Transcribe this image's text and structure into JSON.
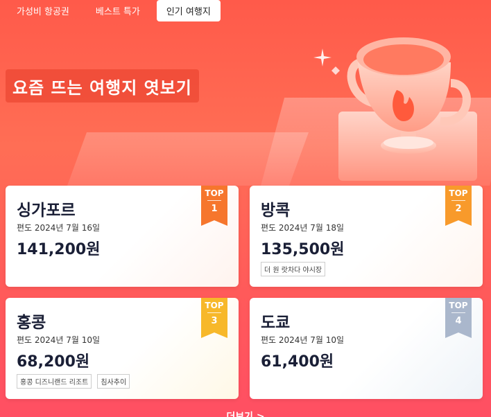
{
  "tabs": [
    {
      "label": "가성비 항공권",
      "active": false
    },
    {
      "label": "베스트 특가",
      "active": false
    },
    {
      "label": "인기 여행지",
      "active": true
    }
  ],
  "hero": {
    "title": "요즘 뜨는 여행지 엿보기"
  },
  "cards": [
    {
      "city": "싱가포르",
      "date": "편도  2024년 7월 16일",
      "price": "141,200원",
      "badge_top": "TOP",
      "badge_num": "1",
      "badge_color": "#f6762d",
      "tags": []
    },
    {
      "city": "방콕",
      "date": "편도  2024년 7월 18일",
      "price": "135,500원",
      "badge_top": "TOP",
      "badge_num": "2",
      "badge_color": "#f89a2b",
      "tags": [
        "더 원 랏차다 야시장"
      ]
    },
    {
      "city": "홍콩",
      "date": "편도  2024년 7월 10일",
      "price": "68,200원",
      "badge_top": "TOP",
      "badge_num": "3",
      "badge_color": "#f7b82a",
      "tags": [
        "홍콩 디즈니랜드 리조트",
        "침사추이"
      ]
    },
    {
      "city": "도쿄",
      "date": "편도  2024년 7월 10일",
      "price": "61,400원",
      "badge_top": "TOP",
      "badge_num": "4",
      "badge_color": "#aab7cc",
      "tags": []
    }
  ],
  "more_label": "더보기 >"
}
